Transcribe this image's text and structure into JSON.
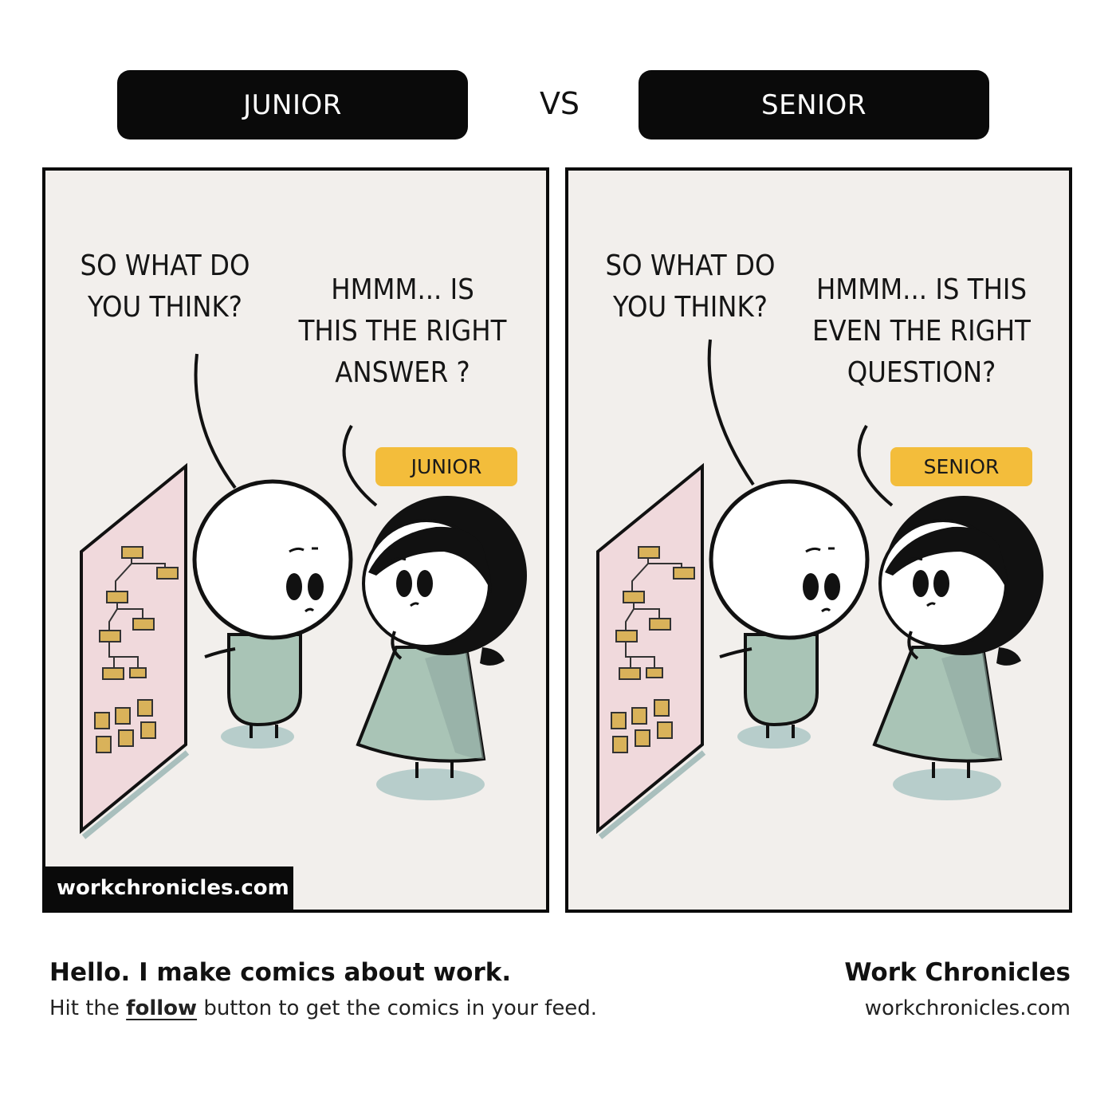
{
  "header": {
    "left_label": "JUNIOR",
    "vs_label": "VS",
    "right_label": "SENIOR"
  },
  "panels": [
    {
      "speech_left": [
        "SO WHAT DO",
        "YOU THINK?"
      ],
      "speech_right": [
        "HMMM... IS",
        "THIS THE RIGHT",
        "ANSWER ?"
      ],
      "tag": "JUNIOR",
      "watermark": "workchronicles.com"
    },
    {
      "speech_left": [
        "SO WHAT DO",
        "YOU THINK?"
      ],
      "speech_right": [
        "HMMM... IS THIS",
        "EVEN THE RIGHT",
        "QUESTION?"
      ],
      "tag": "SENIOR"
    }
  ],
  "footer": {
    "title": "Hello. I make comics about work.",
    "subtitle_before": "Hit the ",
    "subtitle_link": "follow",
    "subtitle_after": " button to get the comics in your feed.",
    "brand_name": "Work Chronicles",
    "brand_url": "workchronicles.com"
  },
  "colors": {
    "panel_bg": "#f2efec",
    "board_pink": "#f0d9dc",
    "body_green": "#a9c4b6",
    "tag_yellow": "#f3bd3b",
    "shadow": "#b7cdcb"
  }
}
